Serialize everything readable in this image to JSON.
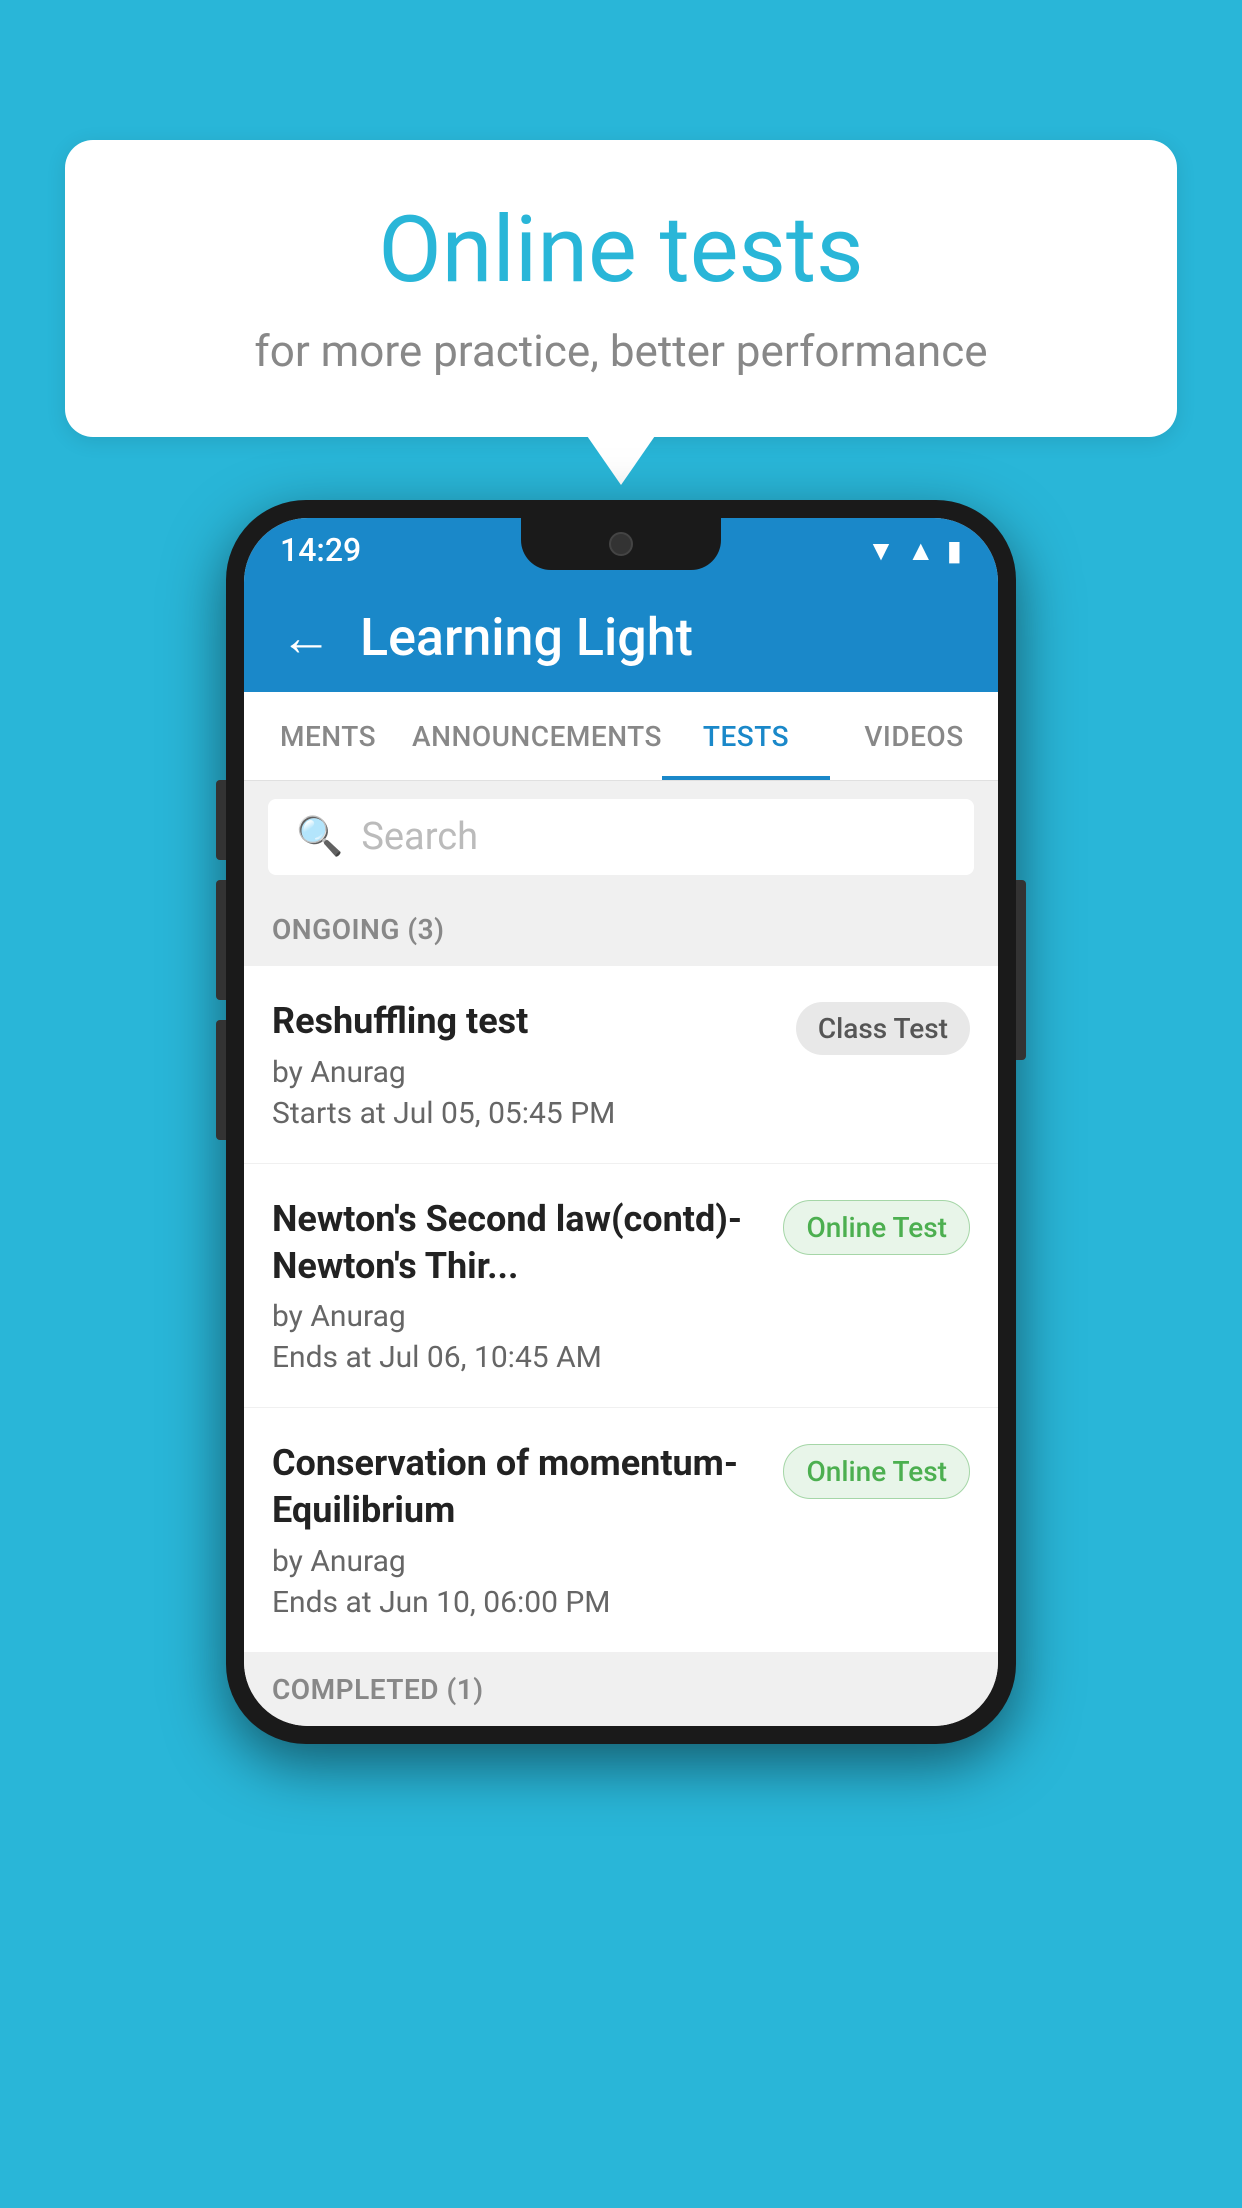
{
  "background_color": "#29b6d8",
  "speech_bubble": {
    "title": "Online tests",
    "subtitle": "for more practice, better performance"
  },
  "phone": {
    "status_bar": {
      "time": "14:29",
      "icons": [
        "wifi",
        "signal",
        "battery"
      ]
    },
    "app_bar": {
      "title": "Learning Light",
      "back_label": "←"
    },
    "tabs": [
      {
        "label": "MENTS",
        "active": false
      },
      {
        "label": "ANNOUNCEMENTS",
        "active": false
      },
      {
        "label": "TESTS",
        "active": true
      },
      {
        "label": "VIDEOS",
        "active": false
      }
    ],
    "search": {
      "placeholder": "Search"
    },
    "ongoing_section": {
      "label": "ONGOING (3)",
      "items": [
        {
          "name": "Reshuffling test",
          "author": "by Anurag",
          "time_label": "Starts at",
          "time": "Jul 05, 05:45 PM",
          "badge": "Class Test",
          "badge_type": "class"
        },
        {
          "name": "Newton's Second law(contd)-Newton's Thir...",
          "author": "by Anurag",
          "time_label": "Ends at",
          "time": "Jul 06, 10:45 AM",
          "badge": "Online Test",
          "badge_type": "online"
        },
        {
          "name": "Conservation of momentum-Equilibrium",
          "author": "by Anurag",
          "time_label": "Ends at",
          "time": "Jun 10, 06:00 PM",
          "badge": "Online Test",
          "badge_type": "online"
        }
      ]
    },
    "completed_section": {
      "label": "COMPLETED (1)"
    }
  }
}
